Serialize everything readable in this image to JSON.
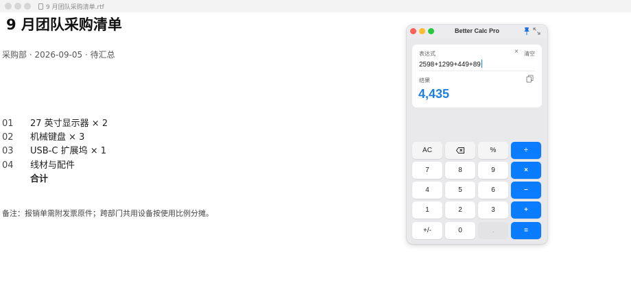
{
  "document": {
    "window_title": "9 月团队采购清单.rtf",
    "heading": "9 月团队采购清单",
    "meta": "采购部 · 2026-09-05 · 待汇总",
    "items": [
      {
        "num": "01",
        "text": "27 英寸显示器 × 2"
      },
      {
        "num": "02",
        "text": "机械键盘 × 3"
      },
      {
        "num": "03",
        "text": "USB-C 扩展坞 × 1"
      },
      {
        "num": "04",
        "text": "线材与配件"
      },
      {
        "num": "",
        "text": "合计"
      }
    ],
    "note": "备注：报销单需附发票原件；跨部门共用设备按使用比例分摊。"
  },
  "calculator": {
    "title": "Better Calc Pro",
    "expression_label": "表达式",
    "clear_label": "清空",
    "clear_icon": "×",
    "expression": "2598+1299+449+89",
    "result_label": "结果",
    "result": "4,435",
    "accent_color": "#0a7cff",
    "keys": [
      [
        "AC",
        "⌫",
        "%",
        "÷"
      ],
      [
        "7",
        "8",
        "9",
        "×"
      ],
      [
        "4",
        "5",
        "6",
        "−"
      ],
      [
        "1",
        "2",
        "3",
        "+"
      ],
      [
        "+/-",
        "0",
        ".",
        "="
      ]
    ]
  }
}
